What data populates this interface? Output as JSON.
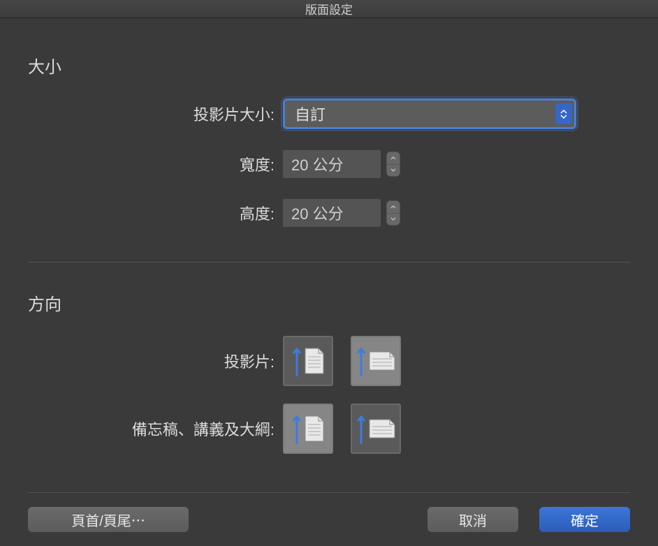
{
  "dialog": {
    "title": "版面設定"
  },
  "size": {
    "section_label": "大小",
    "slide_size_label": "投影片大小:",
    "slide_size_value": "自訂",
    "width_label": "寬度:",
    "width_value": "20 公分",
    "height_label": "高度:",
    "height_value": "20 公分"
  },
  "orientation": {
    "section_label": "方向",
    "slides_label": "投影片:",
    "notes_label": "備忘稿、講義及大綱:",
    "slides_selected": "portrait",
    "notes_selected": "portrait"
  },
  "buttons": {
    "header_footer": "頁首/頁尾⋯",
    "cancel": "取消",
    "confirm": "確定"
  }
}
